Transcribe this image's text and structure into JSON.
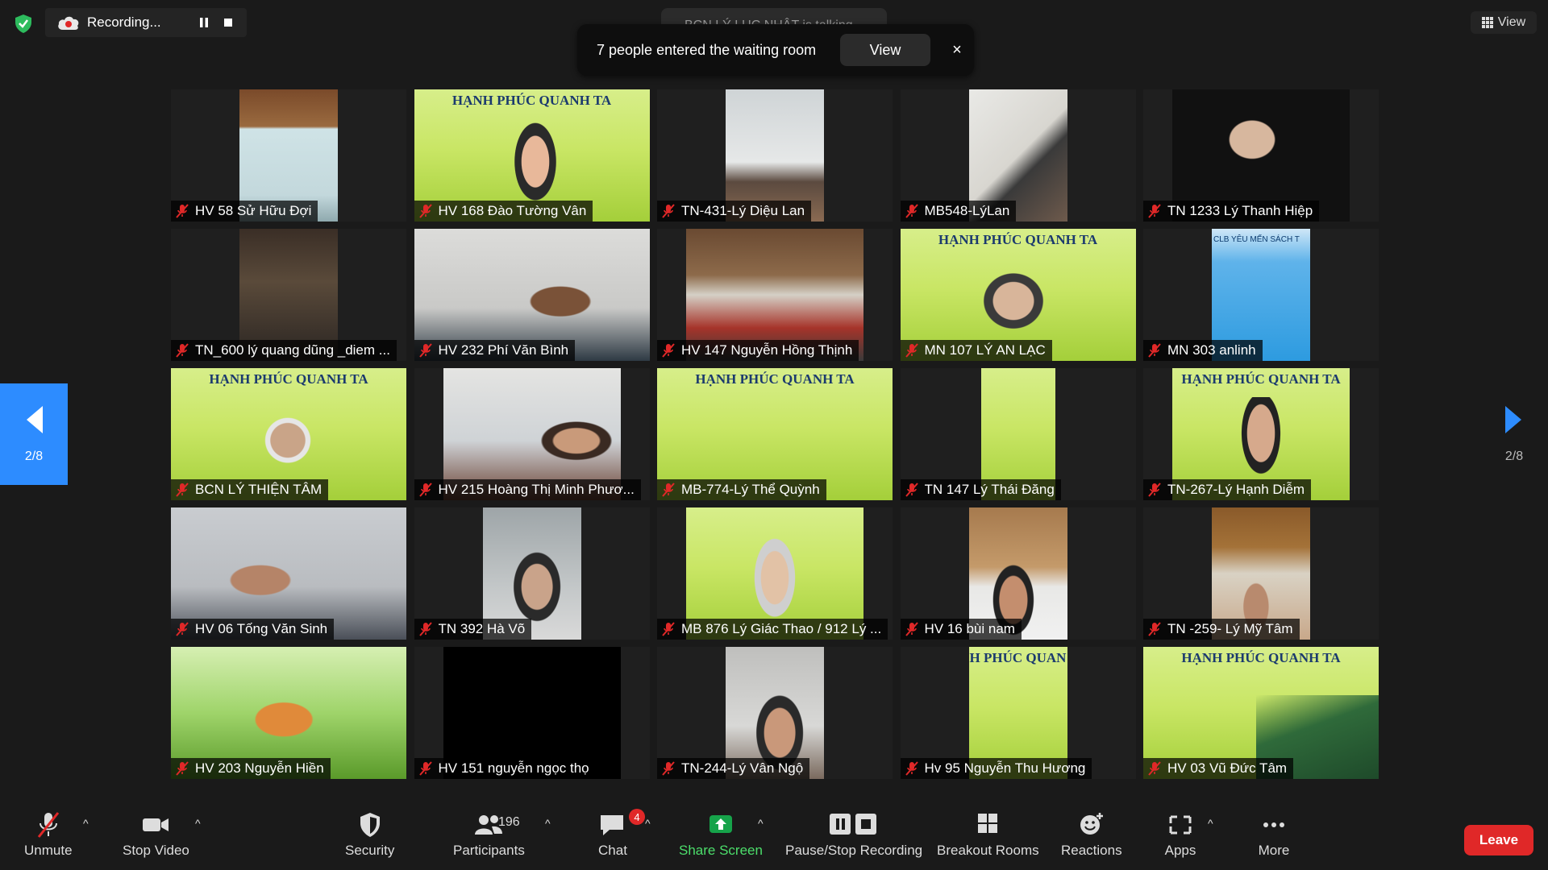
{
  "top": {
    "recording_label": "Recording...",
    "talking_text": "BCN LÝ LỤC NHẬT is talking...",
    "waiting_message": "7 people entered the waiting room",
    "waiting_view": "View",
    "waiting_close": "×",
    "view_label": "View"
  },
  "pager": {
    "left": "2/8",
    "right": "2/8"
  },
  "tiles": [
    {
      "name": "HV 58 Sử Hữu Đợi"
    },
    {
      "name": "HV 168 Đào Tường Vân"
    },
    {
      "name": "TN-431-Lý Diệu Lan"
    },
    {
      "name": "MB548-LýLan"
    },
    {
      "name": "TN 1233 Lý Thanh Hiệp"
    },
    {
      "name": "TN_600 lý quang dũng _diem ..."
    },
    {
      "name": "HV 232 Phí Văn Bình"
    },
    {
      "name": "HV 147 Nguyễn Hồng Thịnh"
    },
    {
      "name": "MN 107 LÝ AN LẠC"
    },
    {
      "name": "MN 303 anlinh"
    },
    {
      "name": "BCN LÝ THIỆN TÂM"
    },
    {
      "name": "HV 215 Hoàng Thị Minh Phươ..."
    },
    {
      "name": "MB-774-Lý Thể Quỳnh"
    },
    {
      "name": "TN 147 Lý Thái Đăng"
    },
    {
      "name": "TN-267-Lý Hạnh Diễm"
    },
    {
      "name": "HV 06 Tống Văn Sinh"
    },
    {
      "name": "TN 392 Hà Võ"
    },
    {
      "name": "MB 876 Lý Giác Thao / 912 Lý ..."
    },
    {
      "name": "HV 16 bùi nam"
    },
    {
      "name": "TN -259- Lý Mỹ Tâm"
    },
    {
      "name": "HV 203 Nguyễn Hiền"
    },
    {
      "name": "HV 151 nguyễn ngọc thọ"
    },
    {
      "name": "TN-244-Lý Vân Ngộ"
    },
    {
      "name": "Hv 95 Nguyễn Thu Hương"
    },
    {
      "name": "HV 03 Vũ Đức Tâm"
    }
  ],
  "banner": {
    "title": "HẠNH PHÚC QUANH TA",
    "title_partial": "H PHÚC QUAN",
    "club_text": "CLB YÊU MẾN SÁCH T"
  },
  "toolbar": {
    "unmute": "Unmute",
    "stop_video": "Stop Video",
    "security": "Security",
    "participants": "Participants",
    "participants_count": "196",
    "chat": "Chat",
    "chat_badge": "4",
    "share_screen": "Share Screen",
    "pause_stop_recording": "Pause/Stop Recording",
    "breakout_rooms": "Breakout Rooms",
    "reactions": "Reactions",
    "apps": "Apps",
    "more": "More",
    "leave": "Leave"
  },
  "colors": {
    "accent": "#2d8cff",
    "leave": "#e02828",
    "share": "#4cde6b",
    "mute": "#e02828"
  }
}
